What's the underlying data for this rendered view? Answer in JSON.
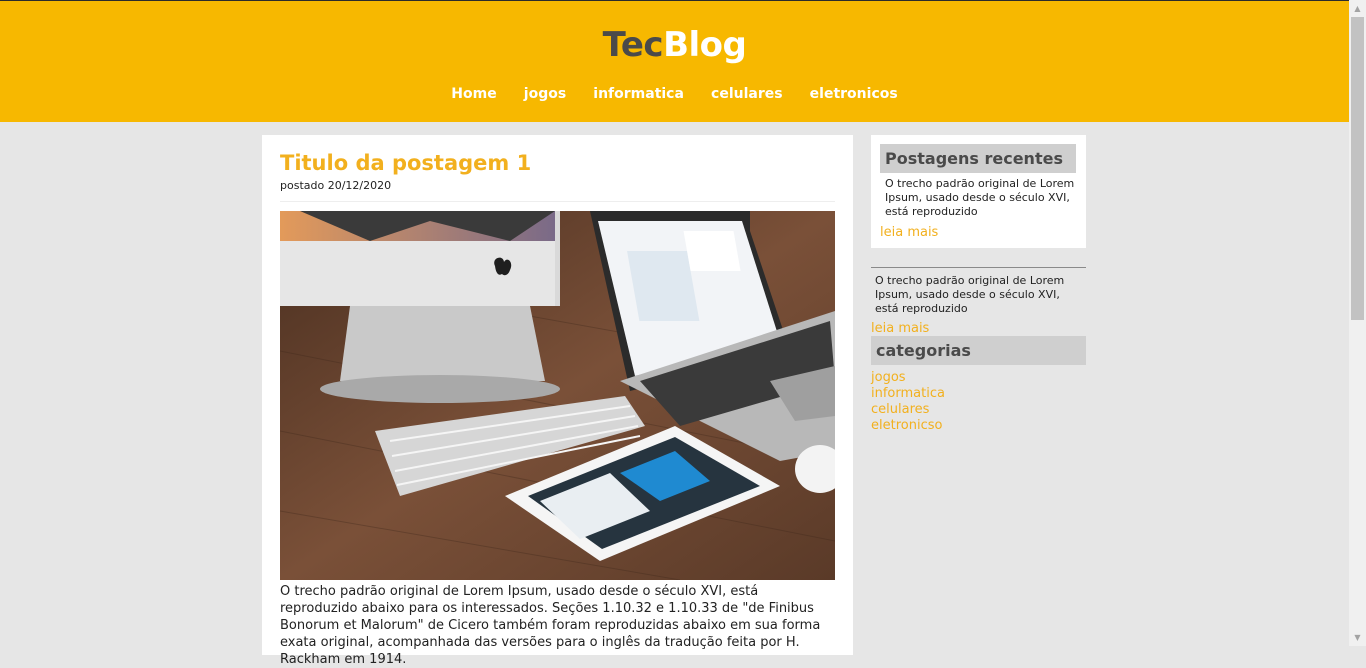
{
  "header": {
    "logo_part1": "Tec",
    "logo_part2": "Blog",
    "nav": [
      "Home",
      "jogos",
      "informatica",
      "celulares",
      "eletronicos"
    ]
  },
  "post": {
    "title": "Titulo da postagem 1",
    "date": "postado 20/12/2020",
    "image_description": "workspace-photo",
    "body": "O trecho padrão original de Lorem Ipsum, usado desde o século XVI, está reproduzido abaixo para os interessados. Seções 1.10.32 e 1.10.33 de \"de Finibus Bonorum et Malorum\" de Cicero também foram reproduzidas abaixo em sua forma exata original, acompanhada das versões para o inglês da tradução feita por H. Rackham em 1914."
  },
  "sidebar": {
    "recent_heading": "Postagens recentes",
    "recent_posts": [
      {
        "excerpt": "O trecho padrão original de Lorem Ipsum, usado desde o século XVI, está reproduzido",
        "more": "leia mais"
      },
      {
        "excerpt": "O trecho padrão original de Lorem Ipsum, usado desde o século XVI, está reproduzido",
        "more": "leia mais"
      }
    ],
    "categories_heading": "categorias",
    "categories": [
      "jogos",
      "informatica",
      "celulares",
      "eletronicso"
    ]
  },
  "colors": {
    "header_bg": "#f7b800",
    "accent": "#f2b01e",
    "page_bg": "#e6e6e6"
  },
  "scrollbar": {
    "up_icon": "arrow-up-icon",
    "down_icon": "arrow-down-icon"
  }
}
